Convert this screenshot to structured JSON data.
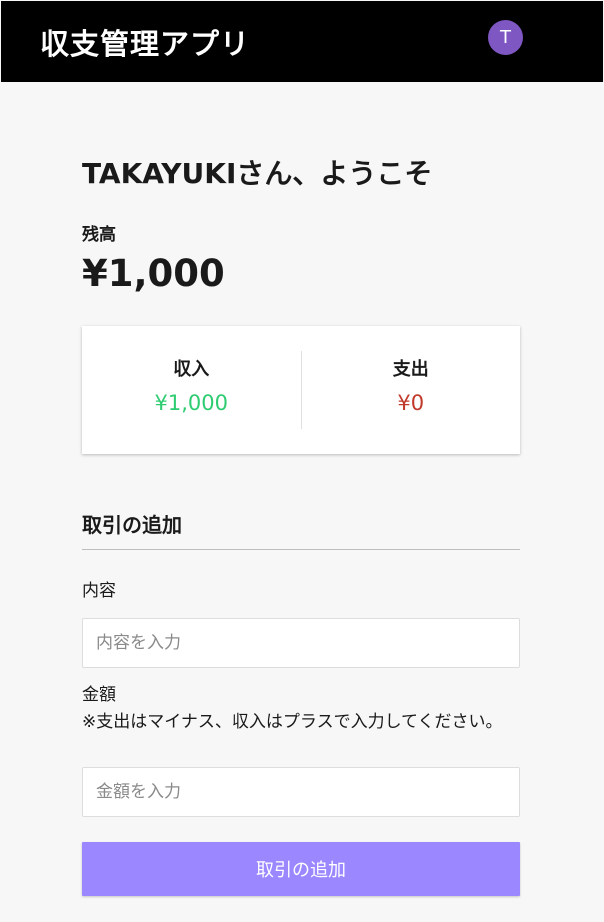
{
  "header": {
    "app_title": "収支管理アプリ",
    "avatar_initial": "T",
    "avatar_color": "#7e57c2"
  },
  "welcome": {
    "message": "TAKAYUKIさん、ようこそ"
  },
  "balance": {
    "label": "残高",
    "value": "¥1,000"
  },
  "summary": {
    "income_label": "収入",
    "income_value": "¥1,000",
    "income_color": "#2ecc71",
    "expense_label": "支出",
    "expense_value": "¥0",
    "expense_color": "#c0392b"
  },
  "add_transaction": {
    "section_title": "取引の追加",
    "content_label": "内容",
    "content_placeholder": "内容を入力",
    "content_value": "",
    "amount_label": "金額\n※支出はマイナス、収入はプラスで入力してください。",
    "amount_placeholder": "金額を入力",
    "amount_value": "",
    "submit_label": "取引の追加",
    "submit_color": "#9b87ff"
  }
}
